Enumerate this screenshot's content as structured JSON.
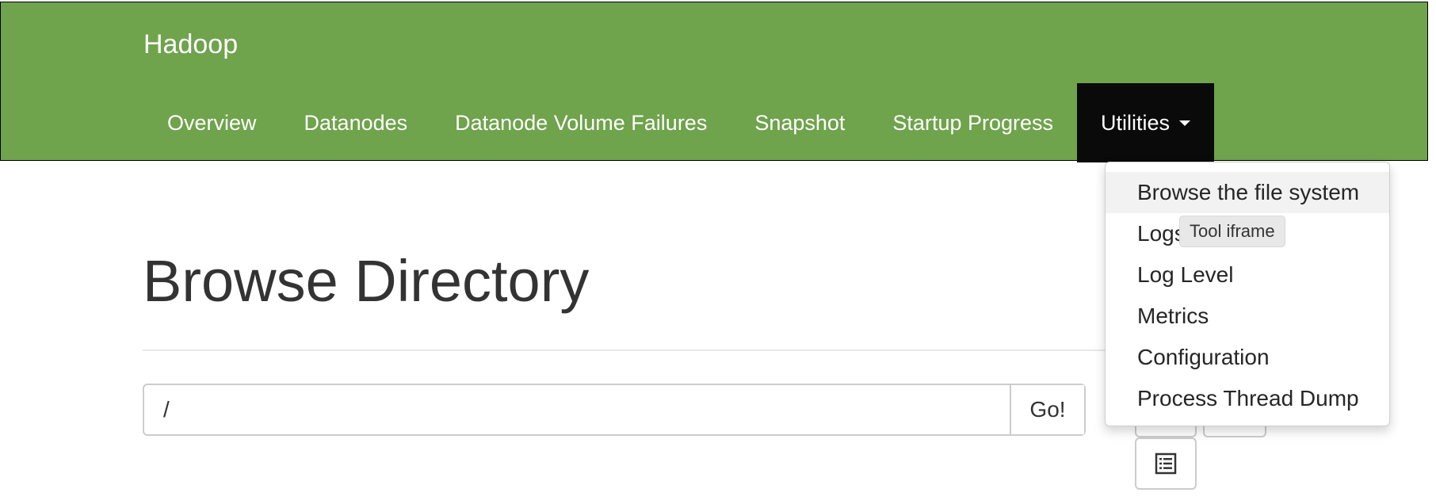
{
  "app": {
    "brand": "Hadoop"
  },
  "nav": {
    "items": [
      {
        "label": "Overview"
      },
      {
        "label": "Datanodes"
      },
      {
        "label": "Datanode Volume Failures"
      },
      {
        "label": "Snapshot"
      },
      {
        "label": "Startup Progress"
      },
      {
        "label": "Utilities"
      }
    ]
  },
  "utilities_menu": {
    "items": [
      {
        "label": "Browse the file system"
      },
      {
        "label": "Logs"
      },
      {
        "label": "Log Level"
      },
      {
        "label": "Metrics"
      },
      {
        "label": "Configuration"
      },
      {
        "label": "Process Thread Dump"
      }
    ]
  },
  "tooltip": {
    "text": "Tool iframe"
  },
  "page": {
    "title": "Browse Directory"
  },
  "path_bar": {
    "value": "/",
    "go_label": "Go!"
  },
  "icons": {
    "list": "list-icon"
  },
  "colors": {
    "navbar": "#6fa34c",
    "active_nav": "#0a0a0a"
  }
}
